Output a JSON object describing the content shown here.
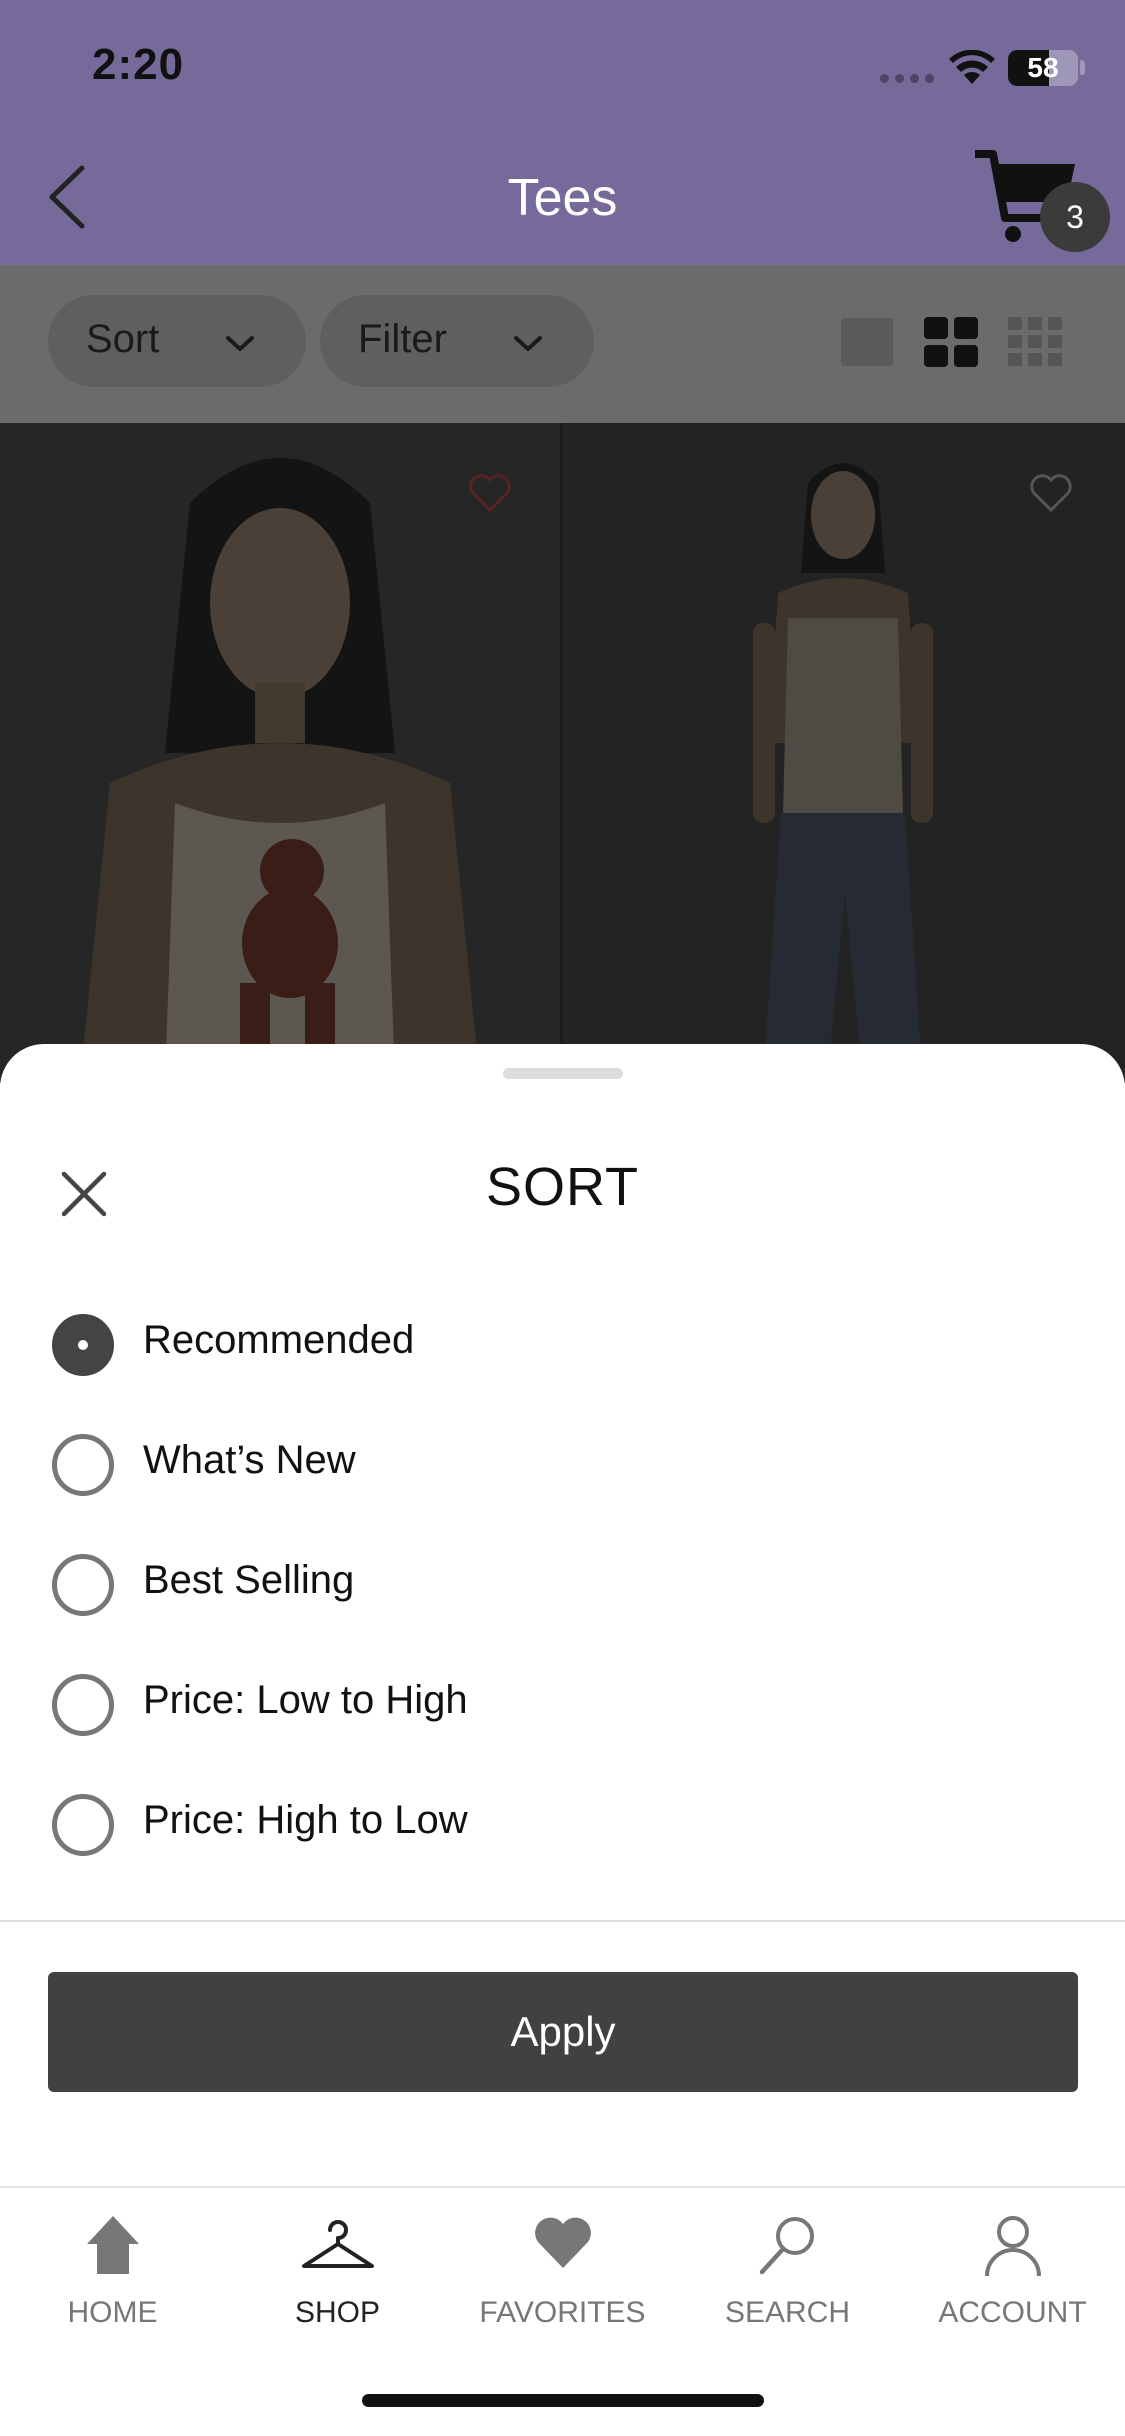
{
  "status_bar": {
    "time": "2:20",
    "battery": "58"
  },
  "nav": {
    "title": "Tees",
    "cart_count": "3"
  },
  "toolbar": {
    "sort_label": "Sort",
    "filter_label": "Filter"
  },
  "sort_sheet": {
    "title": "SORT",
    "options": [
      {
        "label": "Recommended",
        "selected": true
      },
      {
        "label": "What’s New",
        "selected": false
      },
      {
        "label": "Best Selling",
        "selected": false
      },
      {
        "label": "Price: Low to High",
        "selected": false
      },
      {
        "label": "Price: High to Low",
        "selected": false
      }
    ],
    "apply_label": "Apply"
  },
  "tabbar": {
    "items": [
      {
        "label": "HOME",
        "icon": "home-icon"
      },
      {
        "label": "SHOP",
        "icon": "hanger-icon",
        "active": true
      },
      {
        "label": "FAVORITES",
        "icon": "heart-icon"
      },
      {
        "label": "SEARCH",
        "icon": "search-icon"
      },
      {
        "label": "ACCOUNT",
        "icon": "person-icon"
      }
    ]
  },
  "colors": {
    "header": "#766a9a",
    "button": "#414141",
    "overlay": "#6b6b6b"
  }
}
